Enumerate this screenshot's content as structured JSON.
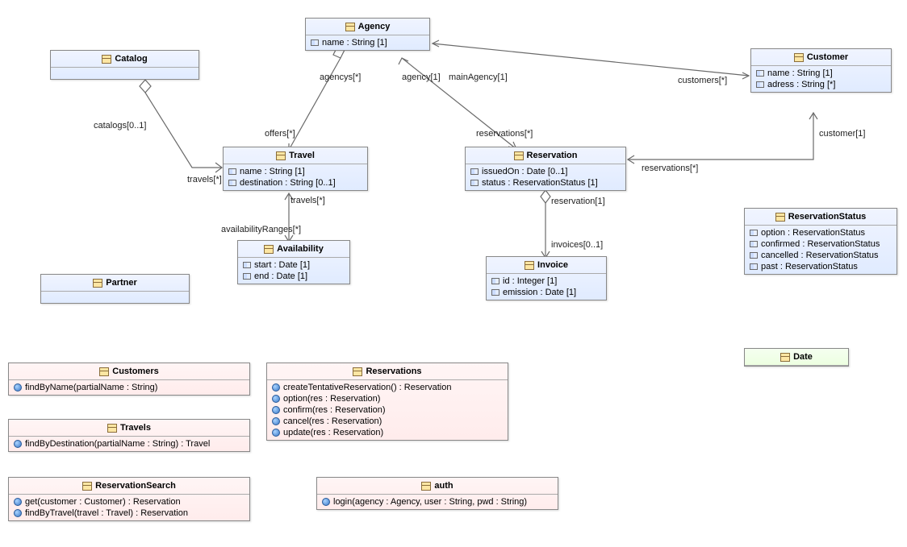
{
  "classes": {
    "catalog": {
      "name": "Catalog"
    },
    "agency": {
      "name": "Agency",
      "attrs": [
        "name : String [1]"
      ]
    },
    "customer": {
      "name": "Customer",
      "attrs": [
        "name : String [1]",
        "adress : String [*]"
      ]
    },
    "travel": {
      "name": "Travel",
      "attrs": [
        "name : String [1]",
        "destination : String [0..1]"
      ]
    },
    "reservation": {
      "name": "Reservation",
      "attrs": [
        "issuedOn : Date [0..1]",
        "status : ReservationStatus [1]"
      ]
    },
    "availability": {
      "name": "Availability",
      "attrs": [
        "start : Date [1]",
        "end : Date [1]"
      ]
    },
    "invoice": {
      "name": "Invoice",
      "attrs": [
        "id : Integer [1]",
        "emission : Date [1]"
      ]
    },
    "reservationStatus": {
      "name": "ReservationStatus",
      "attrs": [
        "option : ReservationStatus",
        "confirmed : ReservationStatus",
        "cancelled : ReservationStatus",
        "past : ReservationStatus"
      ]
    },
    "partner": {
      "name": "Partner"
    },
    "date": {
      "name": "Date"
    },
    "customersSvc": {
      "name": "Customers",
      "ops": [
        "findByName(partialName : String)"
      ]
    },
    "travelsSvc": {
      "name": "Travels",
      "ops": [
        "findByDestination(partialName : String) : Travel"
      ]
    },
    "reservationSearch": {
      "name": "ReservationSearch",
      "ops": [
        "get(customer : Customer) : Reservation",
        "findByTravel(travel : Travel) : Reservation"
      ]
    },
    "reservationsSvc": {
      "name": "Reservations",
      "ops": [
        "createTentativeReservation() : Reservation",
        "option(res : Reservation)",
        "confirm(res : Reservation)",
        "cancel(res : Reservation)",
        "update(res : Reservation)"
      ]
    },
    "auth": {
      "name": "auth",
      "ops": [
        "login(agency : Agency, user : String, pwd : String)"
      ]
    }
  },
  "edgeLabels": {
    "catalogs": "catalogs[0..1]",
    "travels_catalog": "travels[*]",
    "agencys": "agencys[*]",
    "offers": "offers[*]",
    "agency1": "agency[1]",
    "mainAgency": "mainAgency[1]",
    "reservationsTop": "reservations[*]",
    "customersTop": "customers[*]",
    "reservationsRight": "reservations[*]",
    "customer1": "customer[1]",
    "travelsBelow": "travels[*]",
    "availabilityRanges": "availabilityRanges[*]",
    "reservation1": "reservation[1]",
    "invoices": "invoices[0..1]"
  }
}
